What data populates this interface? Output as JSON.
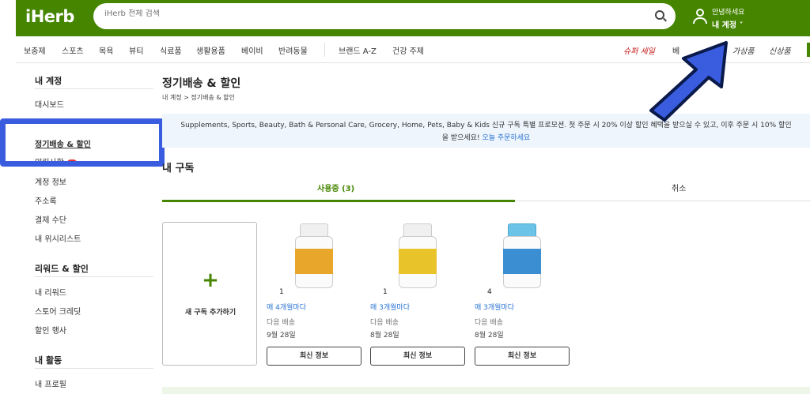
{
  "header": {
    "logo": "iHerb",
    "search_placeholder": "iHerb 전체 검색",
    "greeting": "안녕하세요",
    "account_label": "내 계정 ˅"
  },
  "nav": {
    "items": [
      "보충제",
      "스포츠",
      "목욕",
      "뷰티",
      "식료품",
      "생활용품",
      "베이비",
      "반려동물",
      "브랜드 A-Z",
      "건강 주제"
    ],
    "sale": "슈퍼 세일",
    "partial": "베",
    "extra": "가상품",
    "new": "신상품"
  },
  "sidebar": {
    "section1": "내 계정",
    "dashboard": "대시보드",
    "subscription": "정기배송 & 할인",
    "notifications": "알림사항",
    "account_info": "계정 정보",
    "addresses": "주소록",
    "payment": "결제 수단",
    "wishlist": "내 위시리스트",
    "section2": "리워드 & 할인",
    "my_rewards": "내 리워드",
    "store_credit": "스토어 크레딧",
    "promotions": "할인 행사",
    "section3": "내 활동",
    "profile": "내 프로필"
  },
  "main": {
    "title": "정기배송 & 할인",
    "breadcrumb": "내 계정 > 정기배송 & 할인",
    "promo_text": "Supplements, Sports, Beauty, Bath & Personal Care, Grocery, Home, Pets, Baby & Kids 신규 구독 특별 프로모션. 첫 주문 시 20% 이상 할인 혜택을 받으실 수 있고, 이후 주문 시 10% 할인",
    "promo_text2": "을 받으세요!",
    "promo_link": "오늘 주문하세요",
    "my_subscriptions": "내 구독",
    "tab_active": "사용중 (3)",
    "tab_cancel": "취소",
    "add_plus": "+",
    "add_label": "새 구독 추가하기",
    "next_label": "다음 배송",
    "info_button": "최신 정보"
  },
  "products": [
    {
      "qty": "1",
      "freq": "매 4개월마다",
      "date": "9월 28일",
      "color": "#e8a72a"
    },
    {
      "qty": "1",
      "freq": "매 3개월마다",
      "date": "8월 28일",
      "color": "#e8c32a"
    },
    {
      "qty": "4",
      "freq": "매 3개월마다",
      "date": "8월 28일",
      "color": "#3a8ed1"
    }
  ],
  "colors": {
    "brand_green": "#458500",
    "highlight_blue": "#3a5de0",
    "link_blue": "#2872d1",
    "sale_red": "#c41717"
  }
}
